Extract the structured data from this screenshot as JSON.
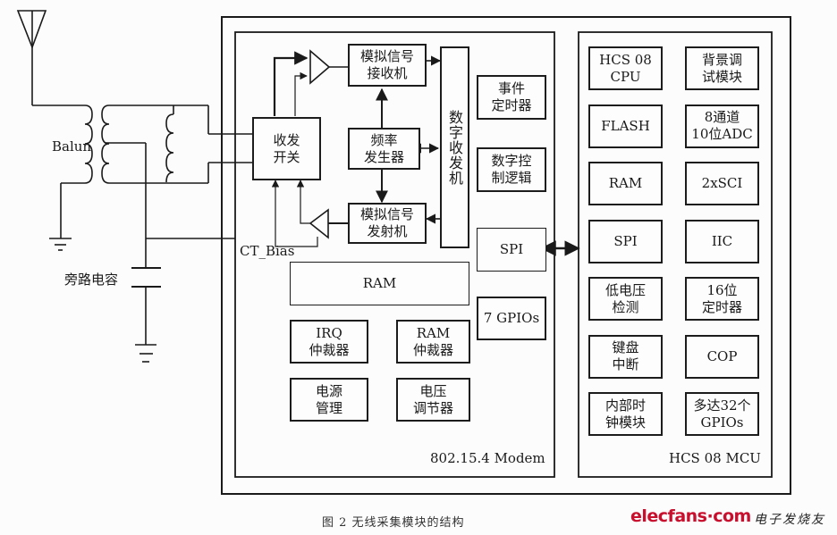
{
  "diagram": {
    "antenna_label": "",
    "balun_label": "Balun",
    "bypass_cap_label": "旁路电容",
    "ct_bias_label": "CT_Bias",
    "modem": {
      "title": "802.15.4 Modem",
      "blocks": {
        "tr_switch": "收发\n开关",
        "analog_rx": "模拟信号\n接收机",
        "analog_tx": "模拟信号\n发射机",
        "freq_gen": "频率\n发生器",
        "digital_transceiver": "数字收发机",
        "event_timer": "事件\n定时器",
        "digital_control": "数字控\n制逻辑",
        "spi": "SPI",
        "gpios": "7 GPIOs",
        "ram": "RAM",
        "irq_arbiter": "IRQ\n仲裁器",
        "ram_arbiter": "RAM\n仲裁器",
        "power_mgmt": "电源\n管理",
        "voltage_reg": "电压\n调节器"
      }
    },
    "mcu": {
      "title": "HCS 08 MCU",
      "blocks": [
        "HCS 08\nCPU",
        "背景调\n试模块",
        "FLASH",
        "8通道\n10位ADC",
        "RAM",
        "2xSCI",
        "SPI",
        "IIC",
        "低电压\n检测",
        "16位\n定时器",
        "键盘\n中断",
        "COP",
        "内部时\n钟模块",
        "多达32个\nGPIOs"
      ]
    }
  },
  "caption": "图 2    无线采集模块的结构",
  "watermark": {
    "logo": "elecfans·com",
    "cn": "电子发烧友",
    "color": "#c8102e"
  }
}
